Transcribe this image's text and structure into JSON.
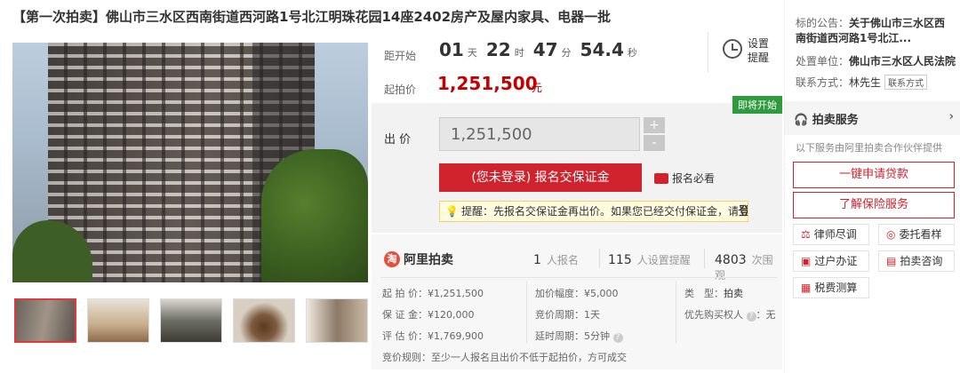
{
  "title": "【第一次拍卖】佛山市三水区西南街道西河路1号北江明珠花园14座2402房产及屋内家具、电器一批",
  "timer": {
    "label": "距开始",
    "days": "01",
    "days_unit": "天",
    "hours": "22",
    "hours_unit": "时",
    "minutes": "47",
    "minutes_unit": "分",
    "seconds": "54.4",
    "seconds_unit": "秒"
  },
  "remind": {
    "label": "设置提醒",
    "icon": "clock-icon"
  },
  "start_price": {
    "label": "起拍价",
    "value": "1,251,500",
    "unit": "元"
  },
  "bid": {
    "badge": "即将开始",
    "label": "出 价",
    "input_value": "1,251,500",
    "plus": "+",
    "minus": "-",
    "signup_button": "(您未登录) 报名交保证金",
    "must_read": "报名必看",
    "tip_prefix": "提醒：先报名交保证金再出价。如果您已经交付保证金，请",
    "tip_login": "登录"
  },
  "info": {
    "logo_text": "阿里拍卖",
    "logo_mark": "淘",
    "stats": [
      {
        "num": "1",
        "label": "人报名"
      },
      {
        "num": "115",
        "label": "人设置提醒"
      },
      {
        "num": "4803",
        "label": "次围观"
      }
    ],
    "rows": [
      [
        "起 拍 价：¥1,251,500",
        "加价幅度：¥5,000",
        "类　型：",
        "拍卖"
      ],
      [
        "保 证 金：¥120,000",
        "竞价周期：1天",
        "优先购买权人",
        "：无"
      ],
      [
        "评 估 价：¥1,769,900",
        "延时周期：5分钟"
      ],
      [
        "竞价规则：",
        "至少一人报名且出价不低于起拍价，方可成交"
      ]
    ]
  },
  "right": {
    "notice_label": "标的公告：",
    "notice_value": "关于佛山市三水区西南街道西河路1号北江...",
    "unit_label": "处置单位：",
    "unit_value": "佛山市三水区人民法院",
    "contact_label": "联系方式：",
    "contact_value": "林先生",
    "contact_button": "联系方式",
    "service_title": "拍卖服务",
    "service_sub": "以下服务由阿里拍卖合作伙伴提供",
    "btn_loan": "一键申请贷款",
    "btn_insurance": "了解保险服务",
    "small": [
      {
        "label": "律师尽调",
        "icon": "lawyer-icon"
      },
      {
        "label": "委托看样",
        "icon": "location-icon"
      },
      {
        "label": "过户办证",
        "icon": "document-icon"
      },
      {
        "label": "拍卖咨询",
        "icon": "chat-icon"
      },
      {
        "label": "税费测算",
        "icon": "calculator-icon"
      }
    ]
  }
}
